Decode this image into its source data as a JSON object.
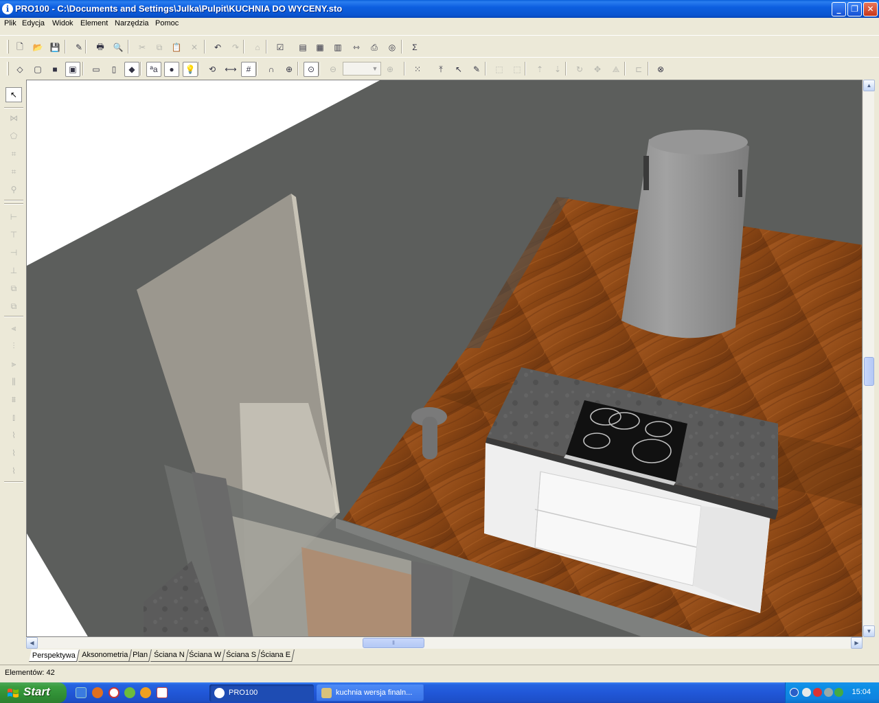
{
  "window": {
    "title": "PRO100 - C:\\Documents and Settings\\Julka\\Pulpit\\KUCHNIA DO WYCENY.sto",
    "app_icon_glyph": "i",
    "minimize_glyph": "_",
    "restore_glyph": "❐",
    "close_glyph": "✕"
  },
  "menu": {
    "items": [
      "Plik",
      "Edycja",
      "Widok",
      "Element",
      "Narzędzia",
      "Pomoc"
    ]
  },
  "toolbar1": {
    "buttons": [
      {
        "name": "new-file-icon",
        "glyph": "🗋"
      },
      {
        "name": "open-file-icon",
        "glyph": "📂"
      },
      {
        "name": "save-icon",
        "glyph": "💾"
      },
      {
        "name": "properties-icon",
        "glyph": "✎"
      },
      {
        "name": "print-icon",
        "glyph": "🖶"
      },
      {
        "name": "print-preview-icon",
        "glyph": "🔍"
      },
      {
        "name": "cut-icon",
        "glyph": "✂"
      },
      {
        "name": "copy-icon",
        "glyph": "⧉"
      },
      {
        "name": "paste-icon",
        "glyph": "📋"
      },
      {
        "name": "delete-icon",
        "glyph": "✕"
      },
      {
        "name": "undo-icon",
        "glyph": "↶"
      },
      {
        "name": "redo-icon",
        "glyph": "↷"
      },
      {
        "name": "library-icon",
        "glyph": "⌂"
      },
      {
        "name": "checklist-icon",
        "glyph": "☑"
      },
      {
        "name": "report-icon",
        "glyph": "▤"
      },
      {
        "name": "report-preview-icon",
        "glyph": "▦"
      },
      {
        "name": "report-settings-icon",
        "glyph": "▥"
      },
      {
        "name": "dimension-report-icon",
        "glyph": "⇿"
      },
      {
        "name": "export-icon",
        "glyph": "⎙"
      },
      {
        "name": "render-icon",
        "glyph": "◎"
      },
      {
        "name": "sum-icon",
        "glyph": "Σ"
      }
    ]
  },
  "toolbar2": {
    "buttons": [
      {
        "name": "view-wireframe-icon",
        "glyph": "◇"
      },
      {
        "name": "view-outline-icon",
        "glyph": "▢"
      },
      {
        "name": "view-solid-icon",
        "glyph": "■"
      },
      {
        "name": "view-shaded-icon",
        "glyph": "▣"
      },
      {
        "name": "view-front-icon",
        "glyph": "▭"
      },
      {
        "name": "view-side-icon",
        "glyph": "▯"
      },
      {
        "name": "view-3d-icon",
        "glyph": "◆"
      },
      {
        "name": "text-labels-icon",
        "glyph": "ªa"
      },
      {
        "name": "texture-icon",
        "glyph": "●"
      },
      {
        "name": "light-bulb-icon",
        "glyph": "💡"
      },
      {
        "name": "measure-icon",
        "glyph": "⟲"
      },
      {
        "name": "ruler-icon",
        "glyph": "⟷"
      },
      {
        "name": "grid-icon",
        "glyph": "#"
      },
      {
        "name": "magnet-icon",
        "glyph": "∩"
      },
      {
        "name": "snap-target-icon",
        "glyph": "⊕"
      },
      {
        "name": "center-target-icon",
        "glyph": "⊙"
      },
      {
        "name": "zoom-out-icon",
        "glyph": "⊖"
      },
      {
        "name": "zoom-in-icon",
        "glyph": "⊕"
      },
      {
        "name": "select-all-icon",
        "glyph": "⁙"
      },
      {
        "name": "insert-icon",
        "glyph": "⤒"
      },
      {
        "name": "pointer-select-icon",
        "glyph": "↖"
      },
      {
        "name": "pencil-icon",
        "glyph": "✎"
      },
      {
        "name": "group-icon",
        "glyph": "⬚"
      },
      {
        "name": "ungroup-icon",
        "glyph": "⬚"
      },
      {
        "name": "move-up-icon",
        "glyph": "⇡"
      },
      {
        "name": "move-down-icon",
        "glyph": "⇣"
      },
      {
        "name": "rotate-icon",
        "glyph": "↻"
      },
      {
        "name": "move-icon",
        "glyph": "✥"
      },
      {
        "name": "mirror-icon",
        "glyph": "⟁"
      },
      {
        "name": "align-icon",
        "glyph": "⊏"
      },
      {
        "name": "lifebuoy-icon",
        "glyph": "⊗"
      }
    ],
    "zoom_value": ""
  },
  "left_tools": {
    "buttons": [
      {
        "name": "select-arrow-icon",
        "glyph": "↖"
      },
      {
        "name": "dimension-tool-icon",
        "glyph": "⋈"
      },
      {
        "name": "shape-tool-icon",
        "glyph": "⬠"
      },
      {
        "name": "edit-tool-icon",
        "glyph": "⌗"
      },
      {
        "name": "edit-tool-2-icon",
        "glyph": "⌗"
      },
      {
        "name": "zoom-tool-icon",
        "glyph": "⚲"
      },
      {
        "name": "align-left-icon",
        "glyph": "⊢"
      },
      {
        "name": "align-top-icon",
        "glyph": "⊤"
      },
      {
        "name": "align-right-icon",
        "glyph": "⊣"
      },
      {
        "name": "align-bottom-icon",
        "glyph": "⊥"
      },
      {
        "name": "copy-tool-icon",
        "glyph": "⧉"
      },
      {
        "name": "copy-tool-2-icon",
        "glyph": "⧉"
      },
      {
        "name": "distribute-left-icon",
        "glyph": "⫷"
      },
      {
        "name": "distribute-center-icon",
        "glyph": "⫶"
      },
      {
        "name": "distribute-right-icon",
        "glyph": "⫸"
      },
      {
        "name": "distribute-h-icon",
        "glyph": "⫼"
      },
      {
        "name": "distribute-v-icon",
        "glyph": "⩩"
      },
      {
        "name": "distribute-size-icon",
        "glyph": "⫾"
      },
      {
        "name": "tool-19-icon",
        "glyph": "⌇"
      },
      {
        "name": "tool-20-icon",
        "glyph": "⌇"
      },
      {
        "name": "tool-21-icon",
        "glyph": "⌇"
      }
    ]
  },
  "view_tabs": [
    "Perspektywa",
    "Aksonometria",
    "Plan",
    "Ściana N",
    "Ściana W",
    "Ściana S",
    "Ściana E"
  ],
  "status": {
    "elements": "Elementów: 42"
  },
  "scrollbar": {
    "up": "▲",
    "down": "▼",
    "left": "◀",
    "right": "▶",
    "grip": "⦀"
  },
  "taskbar": {
    "start_label": "Start",
    "items": [
      {
        "label": "PRO100",
        "active": true
      },
      {
        "label": "kuchnia wersja finaln...",
        "active": false
      }
    ],
    "clock": "15:04"
  },
  "colors": {
    "titlebar": "#0a55d0",
    "floor_wood": "#8a4a1a",
    "wall": "#5a5c5a",
    "counter": "#555555",
    "cooktop": "#111111"
  }
}
